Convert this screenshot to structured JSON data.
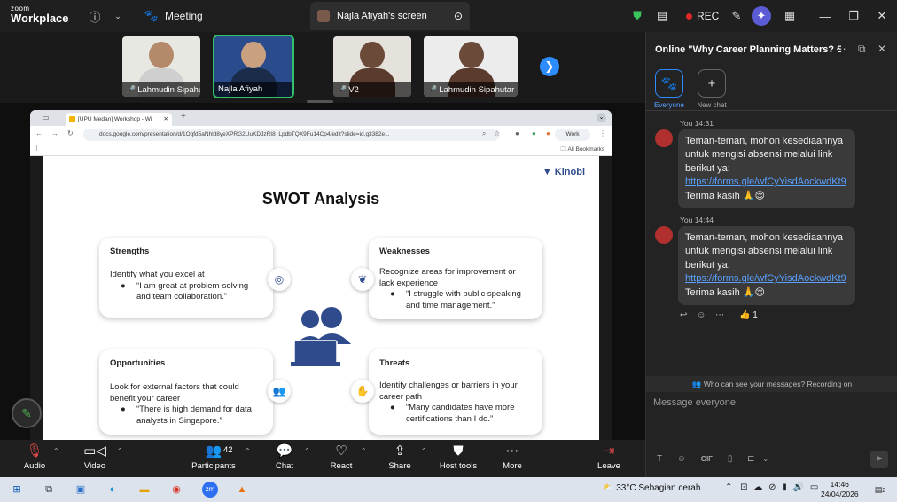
{
  "app": {
    "brand_small": "zoom",
    "brand_big": "Workplace"
  },
  "topbar": {
    "meeting_label": "Meeting",
    "share_tab_label": "Najla Afiyah's screen",
    "rec_label": "REC"
  },
  "gallery": [
    {
      "name": "Lahmudin Sipahutar ...",
      "muted": true
    },
    {
      "name": "Najla Afiyah",
      "muted": false
    },
    {
      "name": "V2",
      "muted": true
    },
    {
      "name": "Lahmudin Sipahutar",
      "muted": true
    }
  ],
  "browser": {
    "tab_title": "[UPU Medan] Workshop - Wi",
    "url": "docs.google.com/presentation/d/1Ogfd5aNhld8yeXPRG2UuKDJzRI8_LpdbTQX9Fu14Cp4/edit?slide=id.g3382e...",
    "profile": "Work",
    "bookmarks": "All Bookmarks"
  },
  "slide": {
    "logo": "Kinobi",
    "title": "SWOT Analysis",
    "cards": {
      "strengths": {
        "title": "Strengths",
        "desc": "Identify what you excel at",
        "bullet": "“I am great at problem-solving and team collaboration.”"
      },
      "weaknesses": {
        "title": "Weaknesses",
        "desc": "Recognize areas for improvement or lack experience",
        "bullet": "“I struggle with public speaking and time management.”"
      },
      "opportunities": {
        "title": "Opportunities",
        "desc": "Look for external factors that could benefit your career",
        "bullet": "“There is high demand for data analysts in Singapore.”"
      },
      "threats": {
        "title": "Threats",
        "desc": "Identify challenges or barriers in your career path",
        "bullet": "“Many candidates have more certifications than I do.”"
      }
    }
  },
  "toolbar": {
    "audio": "Audio",
    "video": "Video",
    "participants": "Participants",
    "participants_count": "42",
    "chat": "Chat",
    "react": "React",
    "share": "Share",
    "host_tools": "Host tools",
    "more": "More",
    "leave": "Leave"
  },
  "chat": {
    "header": "Online \"Why Career Planning Matters? Star...",
    "tab_everyone": "Everyone",
    "tab_new_chat": "New chat",
    "messages": [
      {
        "sender": "You 14:31",
        "line1": "Teman-teman, mohon kesediaannya",
        "line2": "untuk mengisi absensi melalui link",
        "line3": "berikut ya:",
        "link": "https://forms.gle/wfCyYisdAockwdKt9",
        "line4": "Terima kasih 🙏😌"
      },
      {
        "sender": "You 14:44",
        "line1": "Teman-teman, mohon kesediaannya",
        "line2": "untuk mengisi absensi melalui link",
        "line3": "berikut ya:",
        "link": "https://forms.gle/wfCyYisdAockwdKt9",
        "line4": "Terima kasih 🙏😌"
      }
    ],
    "reaction_count": "1",
    "visibility_info": "Who can see your messages? Recording on",
    "compose_placeholder": "Message everyone"
  },
  "taskbar": {
    "weather": "33°C  Sebagian cerah",
    "time": "14:46",
    "date": "24/04/2026",
    "notifications": "2"
  },
  "colors": {
    "accent": "#2d8cff",
    "rec": "#e02828",
    "active_tile": "#32c26a"
  }
}
